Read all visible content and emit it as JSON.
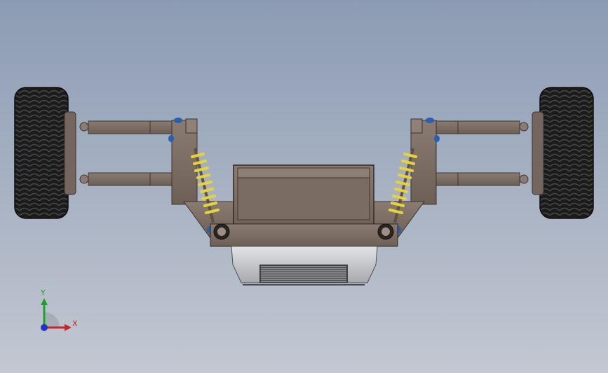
{
  "viewport": {
    "background_top": "#8c9bb4",
    "background_bottom": "#c3c8d2",
    "model": {
      "name": "front-suspension-assembly",
      "part_color": "#7e6f66",
      "spring_color": "#e8d23a",
      "tire_color": "#1a1a1a",
      "fastener_color": "#2a5fb0",
      "radiator_color": "#c9cbcf"
    }
  },
  "triad": {
    "y_label": "Y",
    "x_label": "X",
    "y_color": "#22a02a",
    "x_color": "#c0282c",
    "z_color": "#2233cc"
  }
}
